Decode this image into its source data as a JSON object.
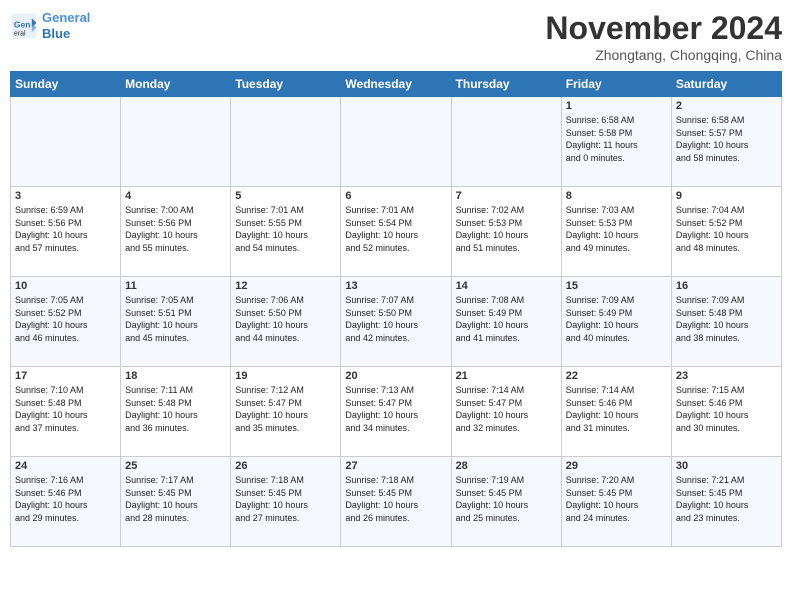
{
  "header": {
    "logo_line1": "General",
    "logo_line2": "Blue",
    "title": "November 2024",
    "subtitle": "Zhongtang, Chongqing, China"
  },
  "weekdays": [
    "Sunday",
    "Monday",
    "Tuesday",
    "Wednesday",
    "Thursday",
    "Friday",
    "Saturday"
  ],
  "weeks": [
    [
      {
        "day": "",
        "info": ""
      },
      {
        "day": "",
        "info": ""
      },
      {
        "day": "",
        "info": ""
      },
      {
        "day": "",
        "info": ""
      },
      {
        "day": "",
        "info": ""
      },
      {
        "day": "1",
        "info": "Sunrise: 6:58 AM\nSunset: 5:58 PM\nDaylight: 11 hours\nand 0 minutes."
      },
      {
        "day": "2",
        "info": "Sunrise: 6:58 AM\nSunset: 5:57 PM\nDaylight: 10 hours\nand 58 minutes."
      }
    ],
    [
      {
        "day": "3",
        "info": "Sunrise: 6:59 AM\nSunset: 5:56 PM\nDaylight: 10 hours\nand 57 minutes."
      },
      {
        "day": "4",
        "info": "Sunrise: 7:00 AM\nSunset: 5:56 PM\nDaylight: 10 hours\nand 55 minutes."
      },
      {
        "day": "5",
        "info": "Sunrise: 7:01 AM\nSunset: 5:55 PM\nDaylight: 10 hours\nand 54 minutes."
      },
      {
        "day": "6",
        "info": "Sunrise: 7:01 AM\nSunset: 5:54 PM\nDaylight: 10 hours\nand 52 minutes."
      },
      {
        "day": "7",
        "info": "Sunrise: 7:02 AM\nSunset: 5:53 PM\nDaylight: 10 hours\nand 51 minutes."
      },
      {
        "day": "8",
        "info": "Sunrise: 7:03 AM\nSunset: 5:53 PM\nDaylight: 10 hours\nand 49 minutes."
      },
      {
        "day": "9",
        "info": "Sunrise: 7:04 AM\nSunset: 5:52 PM\nDaylight: 10 hours\nand 48 minutes."
      }
    ],
    [
      {
        "day": "10",
        "info": "Sunrise: 7:05 AM\nSunset: 5:52 PM\nDaylight: 10 hours\nand 46 minutes."
      },
      {
        "day": "11",
        "info": "Sunrise: 7:05 AM\nSunset: 5:51 PM\nDaylight: 10 hours\nand 45 minutes."
      },
      {
        "day": "12",
        "info": "Sunrise: 7:06 AM\nSunset: 5:50 PM\nDaylight: 10 hours\nand 44 minutes."
      },
      {
        "day": "13",
        "info": "Sunrise: 7:07 AM\nSunset: 5:50 PM\nDaylight: 10 hours\nand 42 minutes."
      },
      {
        "day": "14",
        "info": "Sunrise: 7:08 AM\nSunset: 5:49 PM\nDaylight: 10 hours\nand 41 minutes."
      },
      {
        "day": "15",
        "info": "Sunrise: 7:09 AM\nSunset: 5:49 PM\nDaylight: 10 hours\nand 40 minutes."
      },
      {
        "day": "16",
        "info": "Sunrise: 7:09 AM\nSunset: 5:48 PM\nDaylight: 10 hours\nand 38 minutes."
      }
    ],
    [
      {
        "day": "17",
        "info": "Sunrise: 7:10 AM\nSunset: 5:48 PM\nDaylight: 10 hours\nand 37 minutes."
      },
      {
        "day": "18",
        "info": "Sunrise: 7:11 AM\nSunset: 5:48 PM\nDaylight: 10 hours\nand 36 minutes."
      },
      {
        "day": "19",
        "info": "Sunrise: 7:12 AM\nSunset: 5:47 PM\nDaylight: 10 hours\nand 35 minutes."
      },
      {
        "day": "20",
        "info": "Sunrise: 7:13 AM\nSunset: 5:47 PM\nDaylight: 10 hours\nand 34 minutes."
      },
      {
        "day": "21",
        "info": "Sunrise: 7:14 AM\nSunset: 5:47 PM\nDaylight: 10 hours\nand 32 minutes."
      },
      {
        "day": "22",
        "info": "Sunrise: 7:14 AM\nSunset: 5:46 PM\nDaylight: 10 hours\nand 31 minutes."
      },
      {
        "day": "23",
        "info": "Sunrise: 7:15 AM\nSunset: 5:46 PM\nDaylight: 10 hours\nand 30 minutes."
      }
    ],
    [
      {
        "day": "24",
        "info": "Sunrise: 7:16 AM\nSunset: 5:46 PM\nDaylight: 10 hours\nand 29 minutes."
      },
      {
        "day": "25",
        "info": "Sunrise: 7:17 AM\nSunset: 5:45 PM\nDaylight: 10 hours\nand 28 minutes."
      },
      {
        "day": "26",
        "info": "Sunrise: 7:18 AM\nSunset: 5:45 PM\nDaylight: 10 hours\nand 27 minutes."
      },
      {
        "day": "27",
        "info": "Sunrise: 7:18 AM\nSunset: 5:45 PM\nDaylight: 10 hours\nand 26 minutes."
      },
      {
        "day": "28",
        "info": "Sunrise: 7:19 AM\nSunset: 5:45 PM\nDaylight: 10 hours\nand 25 minutes."
      },
      {
        "day": "29",
        "info": "Sunrise: 7:20 AM\nSunset: 5:45 PM\nDaylight: 10 hours\nand 24 minutes."
      },
      {
        "day": "30",
        "info": "Sunrise: 7:21 AM\nSunset: 5:45 PM\nDaylight: 10 hours\nand 23 minutes."
      }
    ]
  ]
}
